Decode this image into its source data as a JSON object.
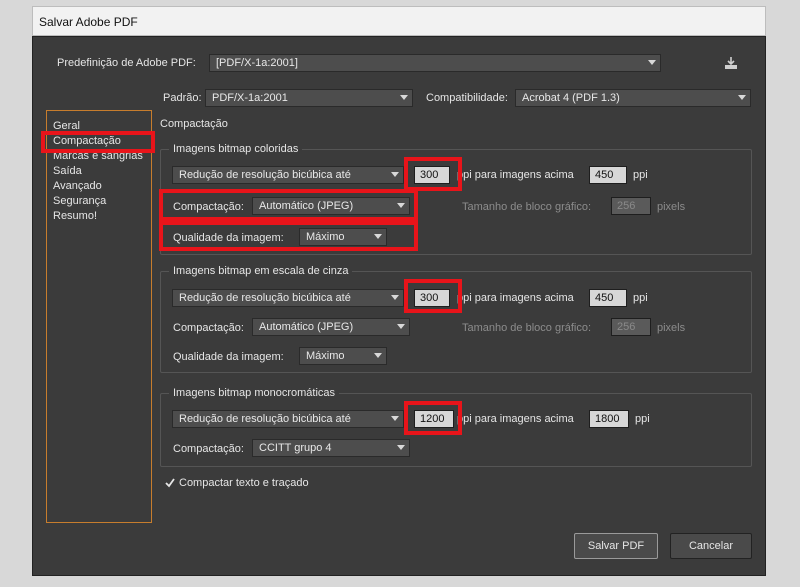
{
  "window": {
    "title": "Salvar Adobe PDF"
  },
  "preset": {
    "label": "Predefinição de Adobe PDF:",
    "value": "[PDF/X-1a:2001]"
  },
  "standard": {
    "label": "Padrão:",
    "value": "PDF/X-1a:2001"
  },
  "compat": {
    "label": "Compatibilidade:",
    "value": "Acrobat 4 (PDF 1.3)"
  },
  "sidebar": {
    "items": [
      {
        "label": "Geral"
      },
      {
        "label": "Compactação"
      },
      {
        "label": "Marcas e sangrias"
      },
      {
        "label": "Saída"
      },
      {
        "label": "Avançado"
      },
      {
        "label": "Segurança"
      },
      {
        "label": "Resumo!"
      }
    ]
  },
  "section_title": "Compactação",
  "color": {
    "title": "Imagens bitmap coloridas",
    "downsample": "Redução de resolução bicúbica até",
    "ppi": "300",
    "above_label": "ppi para imagens acima",
    "above": "450",
    "unit": "ppi",
    "compression_label": "Compactação:",
    "compression": "Automático (JPEG)",
    "tile_label": "Tamanho de bloco gráfico:",
    "tile": "256",
    "tile_unit": "pixels",
    "quality_label": "Qualidade da imagem:",
    "quality": "Máximo"
  },
  "gray": {
    "title": "Imagens bitmap em escala de cinza",
    "downsample": "Redução de resolução bicúbica até",
    "ppi": "300",
    "above_label": "ppi para imagens acima",
    "above": "450",
    "unit": "ppi",
    "compression_label": "Compactação:",
    "compression": "Automático (JPEG)",
    "tile_label": "Tamanho de bloco gráfico:",
    "tile": "256",
    "tile_unit": "pixels",
    "quality_label": "Qualidade da imagem:",
    "quality": "Máximo"
  },
  "mono": {
    "title": "Imagens bitmap monocromáticas",
    "downsample": "Redução de resolução bicúbica até",
    "ppi": "1200",
    "above_label": "ppi para imagens acima",
    "above": "1800",
    "unit": "ppi",
    "compression_label": "Compactação:",
    "compression": "CCITT grupo 4"
  },
  "compress_text": {
    "label": "Compactar texto e traçado",
    "checked": true
  },
  "buttons": {
    "save": "Salvar PDF",
    "cancel": "Cancelar"
  }
}
